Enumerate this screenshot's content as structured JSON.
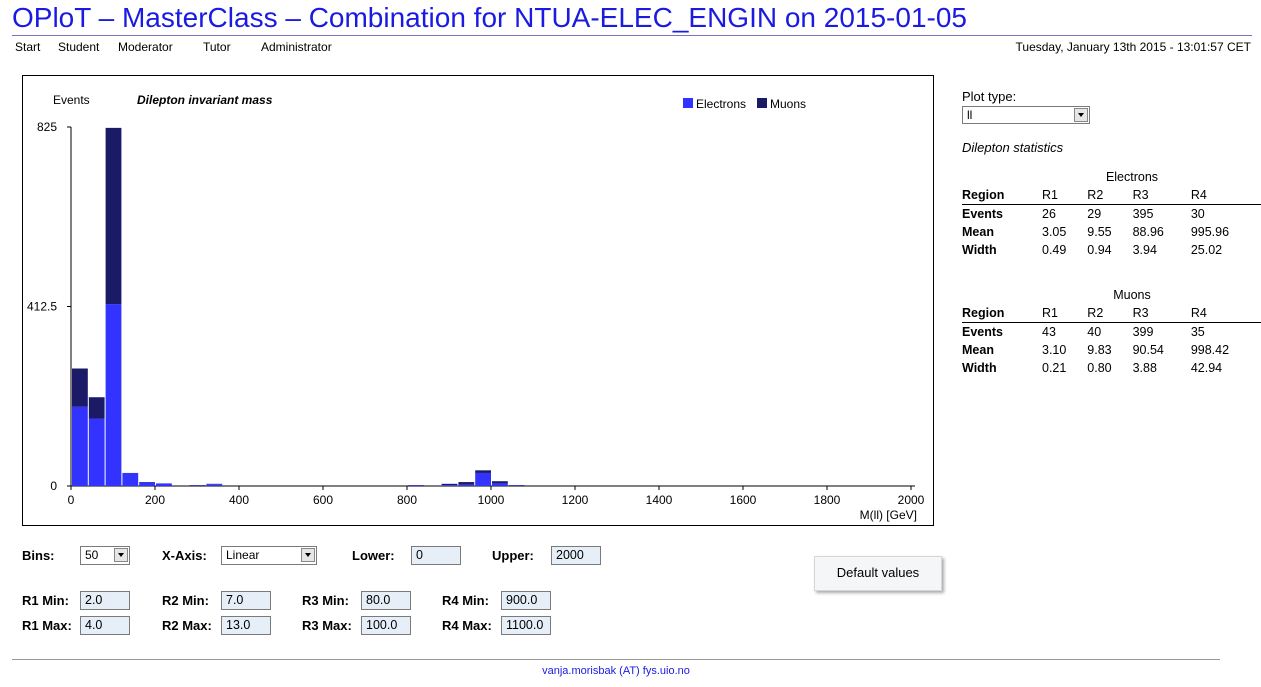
{
  "header": {
    "title": "OPloT – MasterClass – Combination for NTUA-ELEC_ENGIN on 2015-01-05",
    "datetime": "Tuesday, January 13th 2015 - 13:01:57 CET"
  },
  "nav": [
    {
      "label": "Start"
    },
    {
      "label": "Student"
    },
    {
      "label": "Moderator"
    },
    {
      "label": "Tutor"
    },
    {
      "label": "Administrator"
    }
  ],
  "colors": {
    "electrons": "#3333ff",
    "muons": "#1a1a66",
    "title": "#1a1ae0"
  },
  "chart_data": {
    "type": "bar",
    "stacked": true,
    "title": "Dilepton invariant mass",
    "ylabel": "Events",
    "xlabel": "M(ll) [GeV]",
    "xlim": [
      0,
      2000
    ],
    "ylim": [
      0,
      825
    ],
    "bin_width": 40,
    "xticks": [
      0,
      200,
      400,
      600,
      800,
      1000,
      1200,
      1400,
      1600,
      1800,
      2000
    ],
    "yticks": [
      0,
      412.5,
      825
    ],
    "ytick_labels": [
      "0",
      "412.5",
      "825"
    ],
    "legend_position": "top-right",
    "bin_starts": [
      0,
      40,
      80,
      120,
      160,
      200,
      280,
      320,
      800,
      880,
      920,
      960,
      1000,
      1040
    ],
    "series": [
      {
        "name": "Electrons",
        "values": [
          182,
          155,
          418,
          30,
          8,
          6,
          1,
          4,
          1,
          2,
          3,
          30,
          6,
          1
        ]
      },
      {
        "name": "Muons",
        "values": [
          88,
          49,
          405,
          0,
          1,
          0,
          1,
          1,
          1,
          3,
          6,
          6,
          5,
          1
        ]
      }
    ]
  },
  "sidebar": {
    "plot_type_label": "Plot type:",
    "plot_type_value": "ll",
    "stats_title": "Dilepton statistics",
    "electrons": {
      "caption": "Electrons",
      "header": [
        "Region",
        "R1",
        "R2",
        "R3",
        "R4"
      ],
      "rows": [
        [
          "Events",
          "26",
          "29",
          "395",
          "30"
        ],
        [
          "Mean",
          "3.05",
          "9.55",
          "88.96",
          "995.96"
        ],
        [
          "Width",
          "0.49",
          "0.94",
          "3.94",
          "25.02"
        ]
      ]
    },
    "muons": {
      "caption": "Muons",
      "header": [
        "Region",
        "R1",
        "R2",
        "R3",
        "R4"
      ],
      "rows": [
        [
          "Events",
          "43",
          "40",
          "399",
          "35"
        ],
        [
          "Mean",
          "3.10",
          "9.83",
          "90.54",
          "998.42"
        ],
        [
          "Width",
          "0.21",
          "0.80",
          "3.88",
          "42.94"
        ]
      ]
    }
  },
  "controls": {
    "bins_label": "Bins:",
    "bins_value": "50",
    "xaxis_label": "X-Axis:",
    "xaxis_value": "Linear",
    "lower_label": "Lower:",
    "lower_value": "0",
    "upper_label": "Upper:",
    "upper_value": "2000",
    "default_button": "Default values",
    "r1_min_label": "R1 Min:",
    "r1_min": "2.0",
    "r1_max_label": "R1 Max:",
    "r1_max": "4.0",
    "r2_min_label": "R2 Min:",
    "r2_min": "7.0",
    "r2_max_label": "R2 Max:",
    "r2_max": "13.0",
    "r3_min_label": "R3 Min:",
    "r3_min": "80.0",
    "r3_max_label": "R3 Max:",
    "r3_max": "100.0",
    "r4_min_label": "R4 Min:",
    "r4_min": "900.0",
    "r4_max_label": "R4 Max:",
    "r4_max": "1100.0"
  },
  "footer": {
    "contact": "vanja.morisbak (AT) fys.uio.no"
  }
}
